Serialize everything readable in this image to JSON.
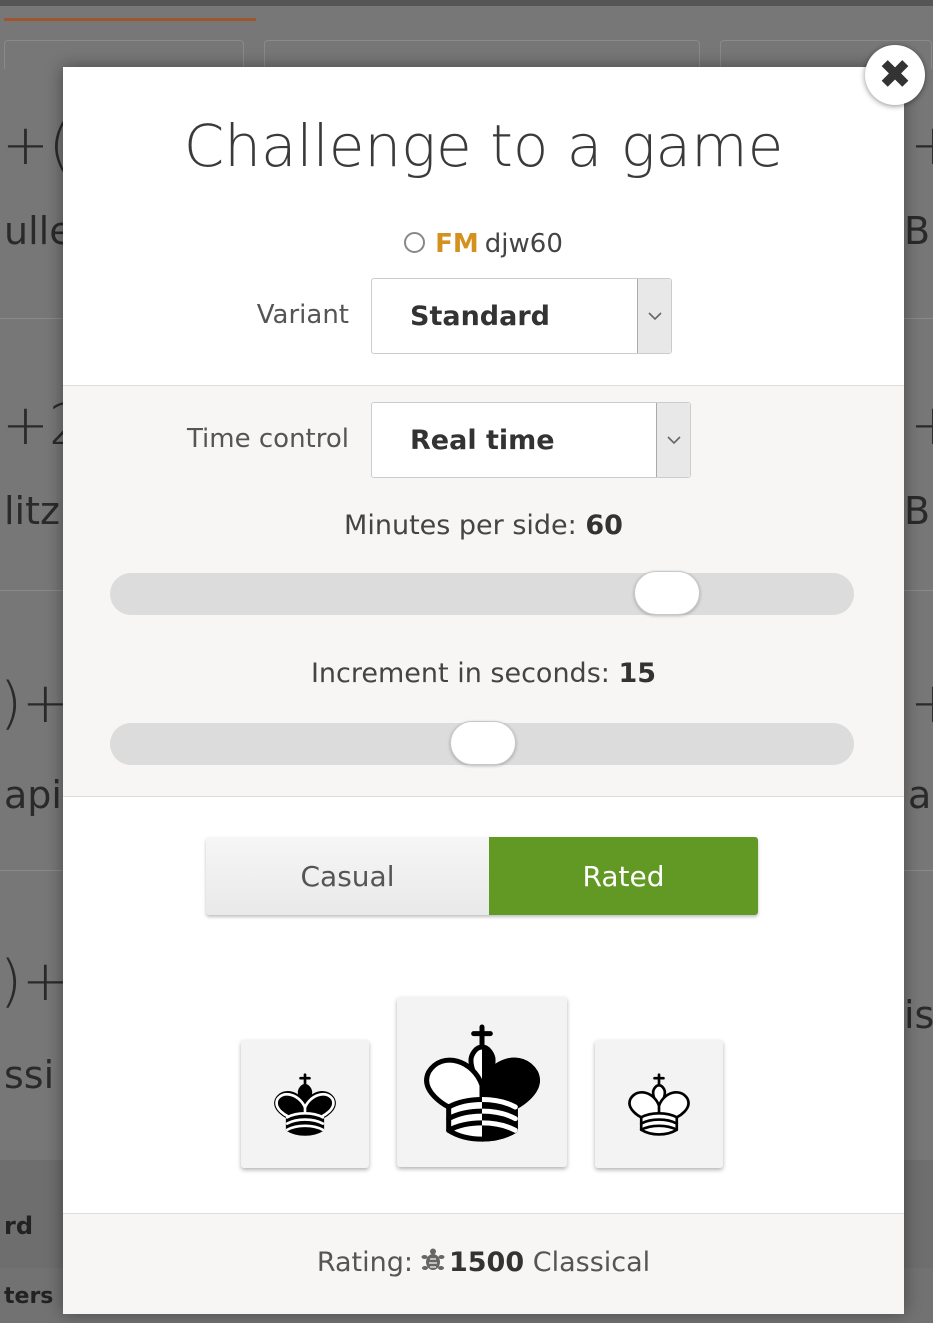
{
  "background": {
    "tiles": [
      {
        "left_big": "+(",
        "left_small": "ulle",
        "right_big": "+",
        "right_small": "Bl"
      },
      {
        "left_big": "+2",
        "left_small": "litz",
        "right_big": "+",
        "right_small": "Bl"
      },
      {
        "left_big": ")+",
        "left_small": "api",
        "right_big": "+",
        "right_small": "a"
      },
      {
        "left_big": ")+",
        "left_small": "ssi",
        "right_big": "",
        "right_small": "is"
      }
    ],
    "table_header": "rd",
    "table_row": "ters"
  },
  "modal": {
    "close_symbol": "✖",
    "title": "Challenge to a game",
    "opponent": {
      "title": "FM",
      "name": "djw60"
    },
    "variant": {
      "label": "Variant",
      "value": "Standard"
    },
    "time_control": {
      "label": "Time control",
      "value": "Real time"
    },
    "minutes": {
      "label": "Minutes per side:",
      "value": "60",
      "fraction": 0.77
    },
    "increment": {
      "label": "Increment in seconds:",
      "value": "15",
      "fraction": 0.5
    },
    "modes": {
      "casual": "Casual",
      "rated": "Rated",
      "selected": "rated"
    },
    "colors": [
      "black",
      "random",
      "white"
    ],
    "rating": {
      "label": "Rating:",
      "value": "1500",
      "type": "Classical",
      "icon": "turtle-icon"
    }
  },
  "colors": {
    "accent_green": "#629924",
    "title_gold": "#d59120"
  }
}
